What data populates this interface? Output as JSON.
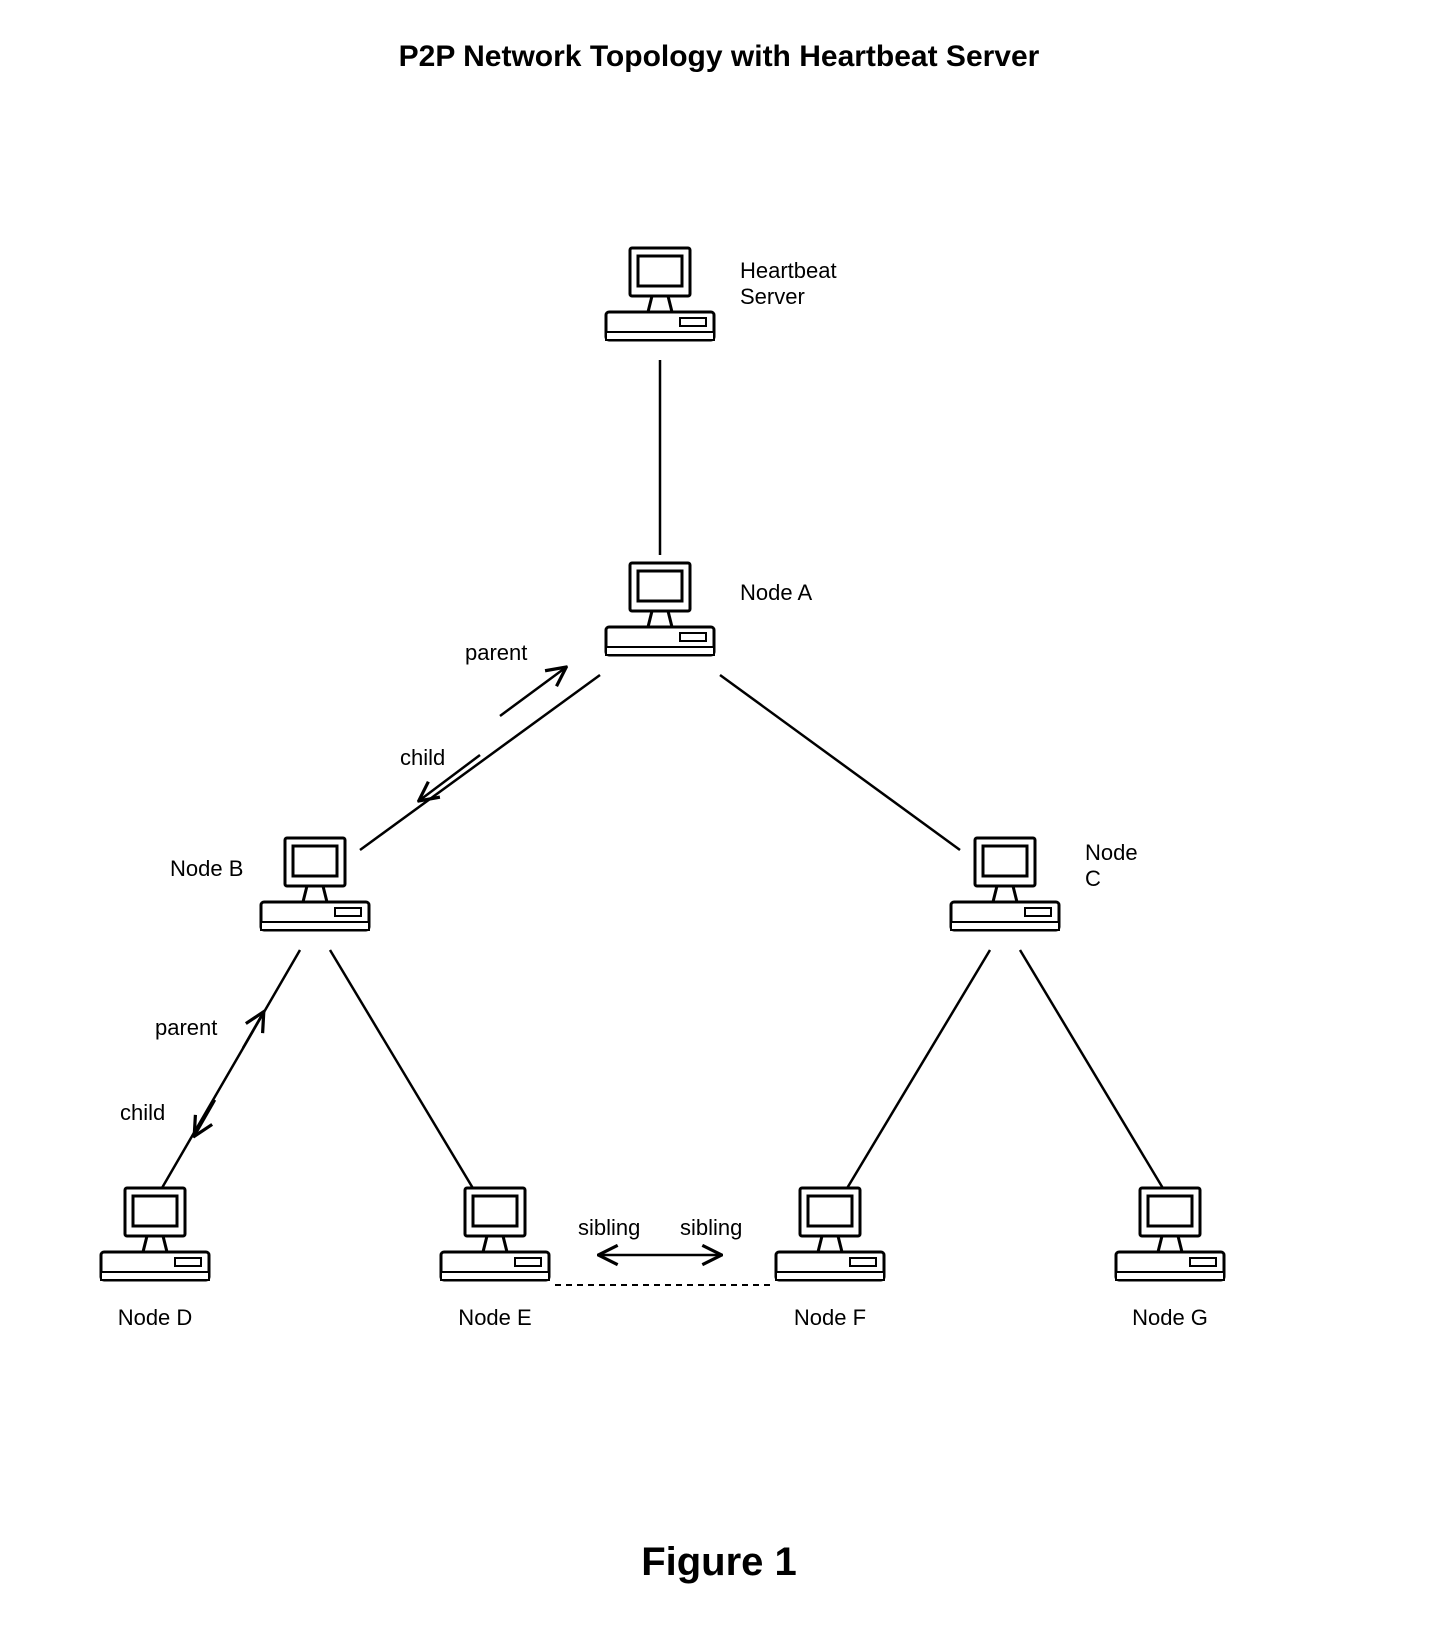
{
  "title": "P2P Network Topology with Heartbeat Server",
  "figure_caption": "Figure 1",
  "nodes": {
    "heartbeat": "Heartbeat\nServer",
    "a": "Node A",
    "b": "Node B",
    "c": "Node\nC",
    "d": "Node D",
    "e": "Node E",
    "f": "Node F",
    "g": "Node G"
  },
  "edge_labels": {
    "parent1": "parent",
    "child1": "child",
    "parent2": "parent",
    "child2": "child",
    "sibling1": "sibling",
    "sibling2": "sibling"
  }
}
